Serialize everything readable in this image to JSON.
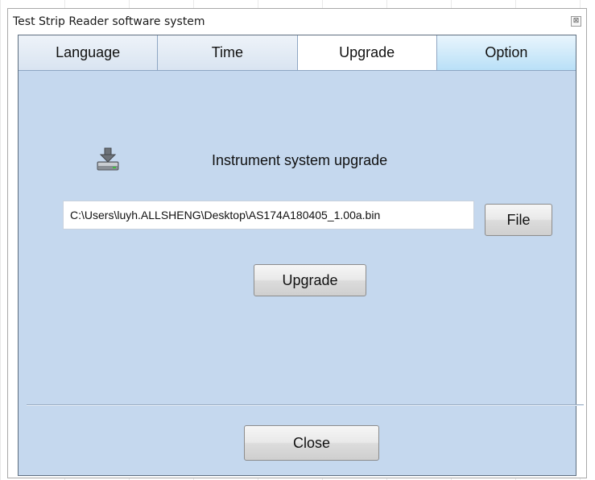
{
  "window": {
    "title": "Test Strip Reader software system",
    "close_glyph": "⊠"
  },
  "tabs": [
    {
      "label": "Language",
      "state": "normal"
    },
    {
      "label": "Time",
      "state": "normal"
    },
    {
      "label": "Upgrade",
      "state": "selected"
    },
    {
      "label": "Option",
      "state": "hover"
    }
  ],
  "upgrade_panel": {
    "icon": "download-drive-icon",
    "heading": "Instrument system upgrade",
    "file_path": "C:\\Users\\luyh.ALLSHENG\\Desktop\\AS174A180405_1.00a.bin",
    "file_button_label": "File",
    "upgrade_button_label": "Upgrade"
  },
  "footer": {
    "close_button_label": "Close"
  },
  "colors": {
    "panel_background": "#c5d8ee",
    "selected_tab": "#ffffff",
    "hover_tab": "#b9e0f7"
  }
}
